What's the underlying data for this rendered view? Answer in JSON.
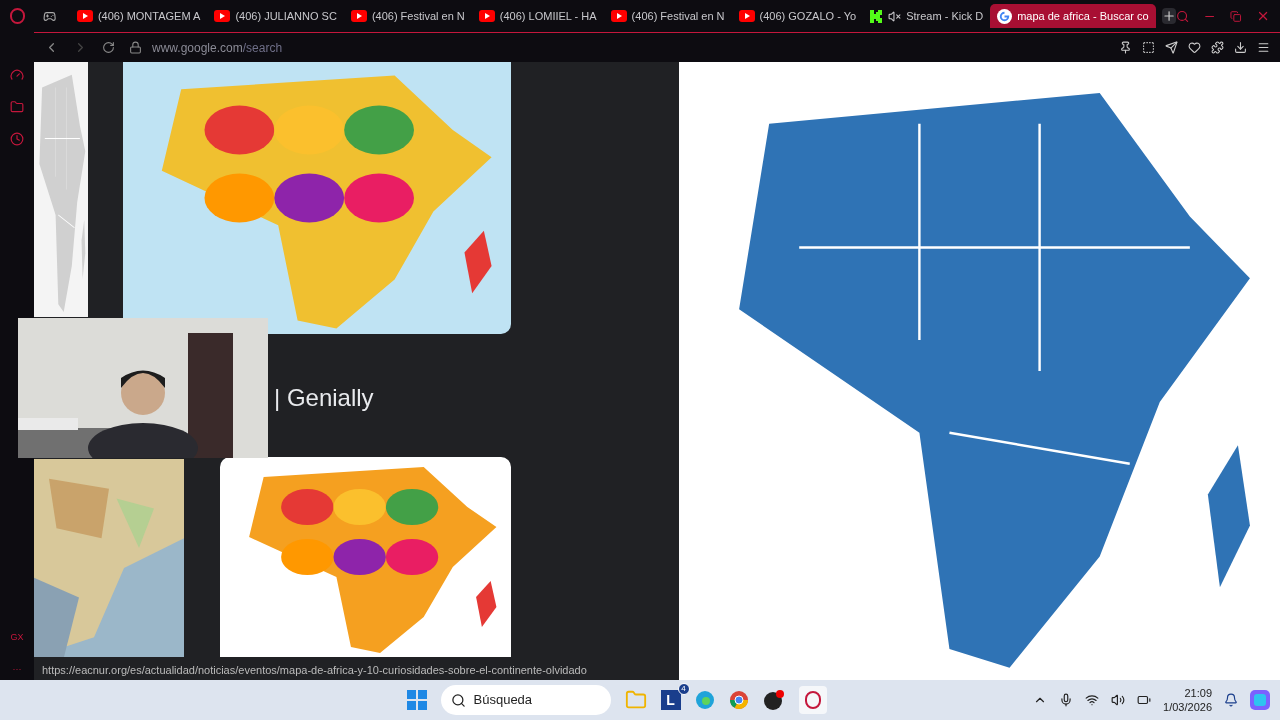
{
  "tabs": [
    {
      "title": "(406) MONTAGEM A",
      "kind": "youtube",
      "selected": false,
      "muted": false
    },
    {
      "title": "(406) JULIANNO SC",
      "kind": "youtube",
      "selected": false,
      "muted": false
    },
    {
      "title": "(406) Festival en N",
      "kind": "youtube",
      "selected": false,
      "muted": false
    },
    {
      "title": "(406) LOMIIEL - HA",
      "kind": "youtube",
      "selected": false,
      "muted": false
    },
    {
      "title": "(406) Festival en N",
      "kind": "youtube",
      "selected": false,
      "muted": false
    },
    {
      "title": "(406) GOZALO - Yo",
      "kind": "youtube",
      "selected": false,
      "muted": false
    },
    {
      "title": "Stream - Kick D",
      "kind": "kick",
      "selected": false,
      "muted": true
    },
    {
      "title": "mapa de africa - Buscar co",
      "kind": "google",
      "selected": true,
      "muted": false
    }
  ],
  "address": {
    "host": "www.google.com",
    "path": "/search"
  },
  "sidebar": {
    "badge": "GX",
    "more": "···"
  },
  "results": {
    "caption": "| Genially"
  },
  "status_url": "https://eacnur.org/es/actualidad/noticias/eventos/mapa-de-africa-y-10-curiosidades-sobre-el-continente-olvidado",
  "taskbar": {
    "search_placeholder": "Búsqueda",
    "app_letter": "L",
    "app_badge": "4",
    "time": "21:09",
    "date": "1/03/2026"
  }
}
